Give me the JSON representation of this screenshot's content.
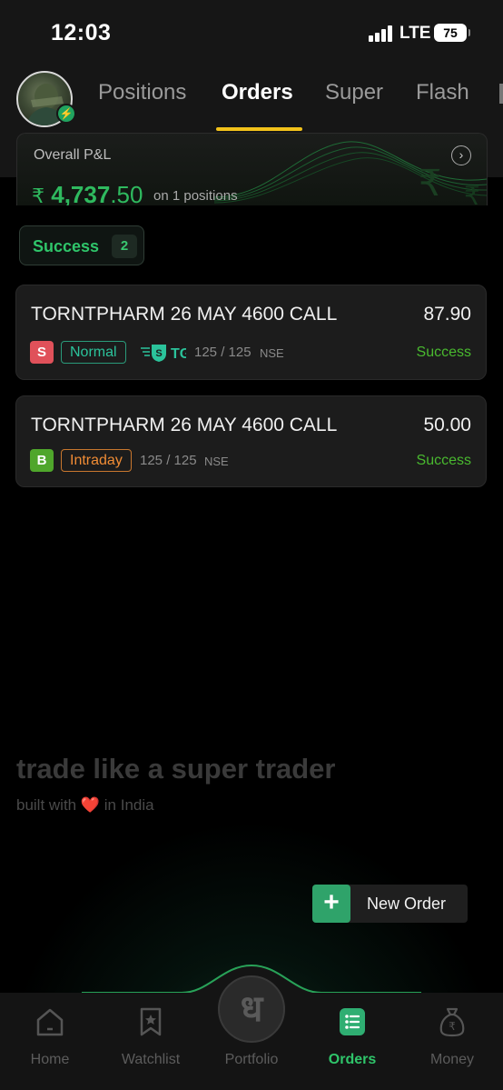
{
  "status_bar": {
    "time": "12:03",
    "network": "LTE",
    "battery": "75"
  },
  "header": {
    "tabs": [
      {
        "label": "Positions",
        "active": false
      },
      {
        "label": "Orders",
        "active": true
      },
      {
        "label": "Super",
        "active": false
      },
      {
        "label": "Flash",
        "active": false
      }
    ]
  },
  "pnl": {
    "label": "Overall P&L",
    "currency": "₹",
    "value_whole": "4,737",
    "value_decimal": ".50",
    "subtitle": "on 1 positions"
  },
  "filter_chip": {
    "label": "Success",
    "count": "2"
  },
  "orders": [
    {
      "name": "TORNTPHARM 26 MAY 4600 CALL",
      "price": "87.90",
      "side": "S",
      "type": "Normal",
      "tg_label": "TG",
      "tg_badge": "S",
      "qty": "125 / 125",
      "exchange": "NSE",
      "status": "Success"
    },
    {
      "name": "TORNTPHARM 26 MAY 4600 CALL",
      "price": "50.00",
      "side": "B",
      "type": "Intraday",
      "qty": "125 / 125",
      "exchange": "NSE",
      "status": "Success"
    }
  ],
  "tagline": {
    "title": "trade like a super trader",
    "prefix": "built with",
    "heart": "❤️",
    "suffix": "in India"
  },
  "new_order": {
    "label": "New Order",
    "icon": "plus-icon"
  },
  "bottom_nav": {
    "items": [
      {
        "label": "Home",
        "icon": "home-icon"
      },
      {
        "label": "Watchlist",
        "icon": "bookmark-star-icon"
      },
      {
        "label": "Portfolio",
        "icon": "portfolio-logo-icon"
      },
      {
        "label": "Orders",
        "icon": "orders-list-icon",
        "active": true
      },
      {
        "label": "Money",
        "icon": "money-bag-icon"
      }
    ],
    "portfolio_glyph": "ध"
  },
  "colors": {
    "accent_green": "#2fc56a",
    "tab_underline": "#f2c21a",
    "sell_red": "#e0515a",
    "buy_green": "#4fa62b",
    "intraday_orange": "#f08c35",
    "normal_teal": "#2bc39b"
  }
}
